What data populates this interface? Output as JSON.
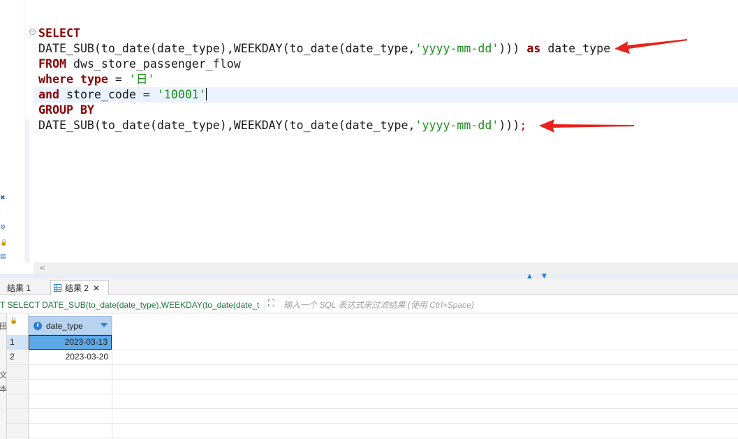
{
  "editor": {
    "lines": [
      [
        {
          "t": "SELECT",
          "c": "kw"
        }
      ],
      [
        {
          "t": "DATE_SUB(to_date(date_type),WEEKDAY(to_date(date_type,"
        },
        {
          "t": "'yyyy-mm-dd'",
          "c": "str"
        },
        {
          "t": "))) "
        },
        {
          "t": "as",
          "c": "kw"
        },
        {
          "t": " date_type"
        }
      ],
      [
        {
          "t": "FROM",
          "c": "kw"
        },
        {
          "t": " dws_store_passenger_flow"
        }
      ],
      [
        {
          "t": "where",
          "c": "kw"
        },
        {
          "t": " "
        },
        {
          "t": "type",
          "c": "kw"
        },
        {
          "t": " = "
        },
        {
          "t": "'日'",
          "c": "str"
        }
      ],
      [
        {
          "t": "and",
          "c": "kw"
        },
        {
          "t": " store_code = "
        },
        {
          "t": "'10001'",
          "c": "str"
        },
        {
          "t": "",
          "c": "caret"
        }
      ],
      [
        {
          "t": "GROUP BY",
          "c": "kw"
        }
      ],
      [
        {
          "t": "DATE_SUB(to_date(date_type),WEEKDAY(to_date(date_type,"
        },
        {
          "t": "'yyyy-mm-dd'",
          "c": "str"
        },
        {
          "t": ")))"
        },
        {
          "t": ";",
          "c": "semi"
        }
      ]
    ]
  },
  "colors": {
    "keyword": "#8b0000",
    "string": "#1f8f1f",
    "annotation_arrow": "#e8231b",
    "selection": "#5ea9e8",
    "column_header": "#b7d3ef"
  },
  "tabs": [
    {
      "label": "结果 1",
      "active": false
    },
    {
      "label": "结果 2",
      "active": true
    }
  ],
  "filter": {
    "sql_echo": "T SELECT DATE_SUB(to_date(date_type),WEEKDAY(to_date(date_t",
    "placeholder": "输入一个 SQL 表达式来过滤结果 (使用 Ctrl+Space)"
  },
  "side_panel": {
    "labels": [
      "田",
      "文",
      "本"
    ]
  },
  "result": {
    "column": "date_type",
    "rows": [
      {
        "num": "1",
        "value": "2023-03-13",
        "selected": true
      },
      {
        "num": "2",
        "value": "2023-03-20",
        "selected": false
      }
    ]
  }
}
